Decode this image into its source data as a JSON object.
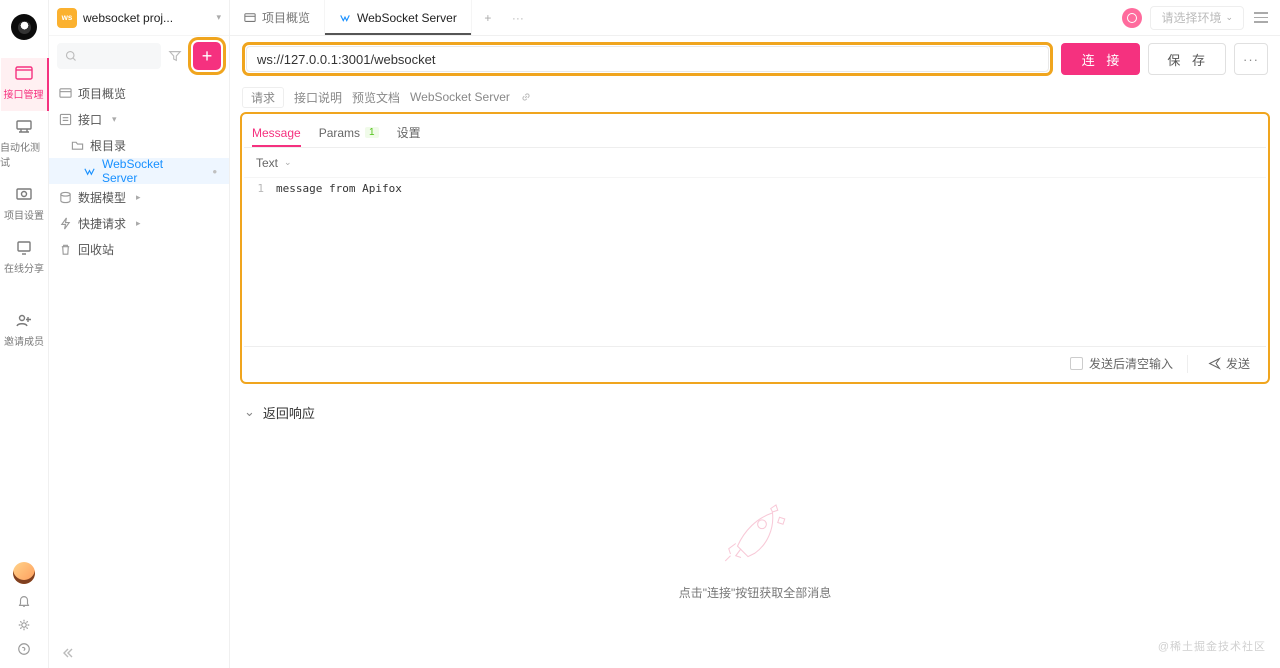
{
  "rail": {
    "items": [
      {
        "label": "接口管理"
      },
      {
        "label": "自动化测试"
      },
      {
        "label": "项目设置"
      },
      {
        "label": "在线分享"
      },
      {
        "label": "邀请成员"
      }
    ]
  },
  "project": {
    "name": "websocket proj..."
  },
  "sidebar": {
    "overview": "项目概览",
    "api": "接口",
    "root": "根目录",
    "wsserver": "WebSocket Server",
    "datamodel": "数据模型",
    "quickreq": "快捷请求",
    "trash": "回收站"
  },
  "tabs": {
    "overview": "项目概览",
    "ws": "WebSocket Server"
  },
  "env": {
    "placeholder": "请选择环境"
  },
  "url": {
    "value": "ws://127.0.0.1:3001/websocket"
  },
  "buttons": {
    "connect": "连 接",
    "save": "保 存",
    "more": "···"
  },
  "crumbs": {
    "request": "请求",
    "apidesc": "接口说明",
    "preview": "预览文档",
    "ws": "WebSocket Server"
  },
  "panelTabs": {
    "message": "Message",
    "params": "Params",
    "paramsCount": "1",
    "settings": "设置"
  },
  "format": {
    "text": "Text"
  },
  "editor": {
    "line": "1",
    "content": "message from Apifox"
  },
  "panelFooter": {
    "clear": "发送后清空输入",
    "send": "发送"
  },
  "response": {
    "title": "返回响应",
    "empty": "点击\"连接\"按钮获取全部消息"
  },
  "watermark": "@稀土掘金技术社区"
}
